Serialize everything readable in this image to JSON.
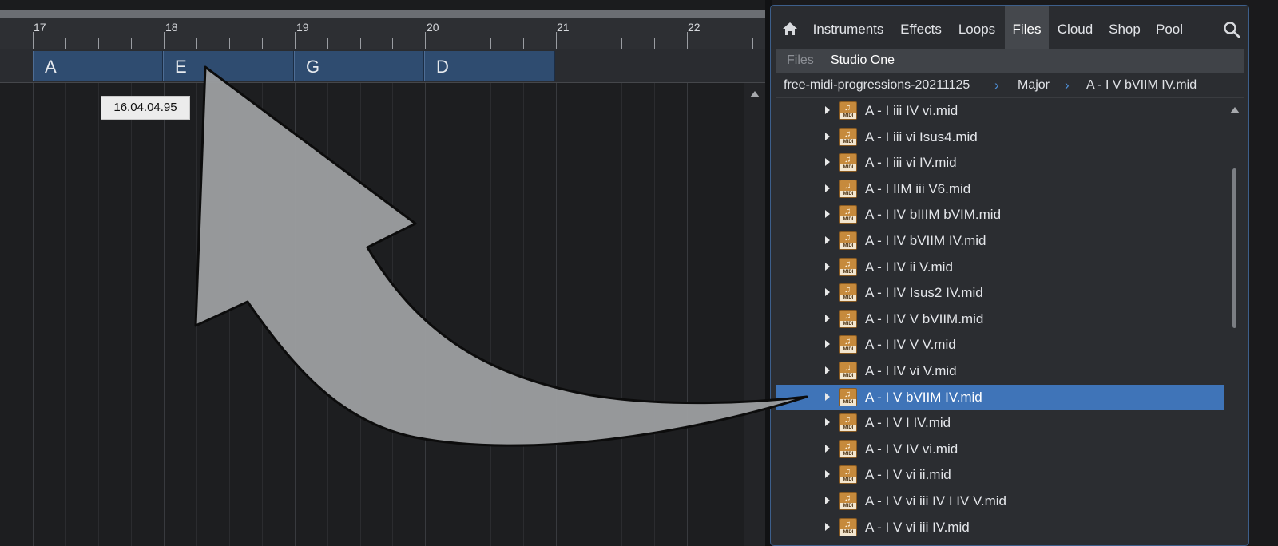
{
  "arrangement": {
    "ruler": [
      "17",
      "18",
      "19",
      "20",
      "21",
      "22"
    ],
    "chords": [
      "A",
      "E",
      "G",
      "D"
    ],
    "timecode": "16.04.04.95"
  },
  "browser": {
    "tabs": [
      "Instruments",
      "Effects",
      "Loops",
      "Files",
      "Cloud",
      "Shop",
      "Pool"
    ],
    "active_tab": "Files",
    "subbar": {
      "files": "Files",
      "studio_one": "Studio One"
    },
    "breadcrumb": [
      "free-midi-progressions-20211125",
      "Major",
      "A - I V bVIIM IV.mid"
    ],
    "files": [
      "A - I iii IV vi.mid",
      "A - I iii vi Isus4.mid",
      "A - I iii vi IV.mid",
      "A - I IIM iii V6.mid",
      "A - I IV bIIIM bVIM.mid",
      "A - I IV bVIIM IV.mid",
      "A - I IV ii V.mid",
      "A - I IV Isus2 IV.mid",
      "A - I IV V bVIIM.mid",
      "A - I IV V V.mid",
      "A - I IV vi V.mid",
      "A - I V bVIIM IV.mid",
      "A - I V I IV.mid",
      "A - I V IV vi.mid",
      "A - I V vi ii.mid",
      "A - I V vi iii IV I IV V.mid",
      "A - I V vi iii IV.mid"
    ],
    "selected_file": "A - I V bVIIM IV.mid",
    "midi_tag": "MIDI",
    "note_glyph": "♫"
  },
  "icons": {
    "home": "home-icon",
    "search": "search-icon",
    "expand": "expand-arrow-icon",
    "midi": "midi-file-icon",
    "drag_arrow": "curved-drag-arrow"
  },
  "colors": {
    "chord_block": "#2f4c70",
    "selection": "#3f74b8",
    "crumb_separator": "#4f8fd6",
    "midi_icon": "#c68a3c",
    "arrow_fill": "#9b9d9f"
  }
}
